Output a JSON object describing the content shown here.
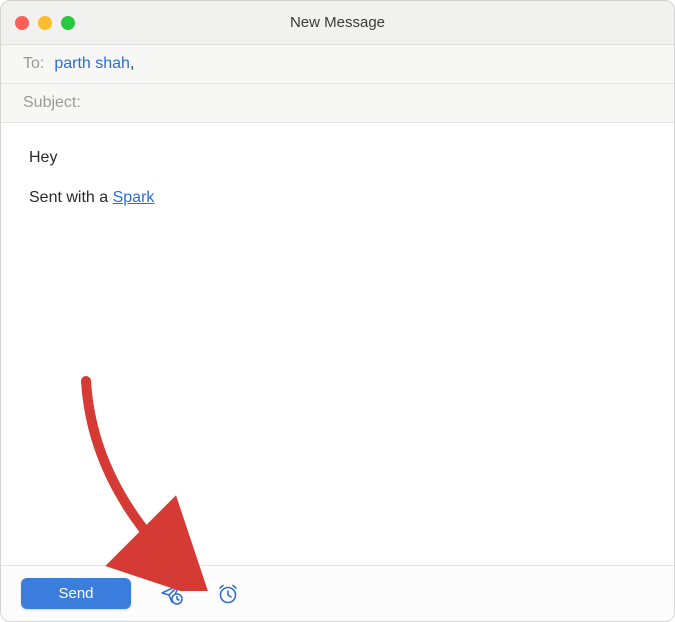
{
  "titlebar": {
    "title": "New Message"
  },
  "to": {
    "label": "To:",
    "recipient": "parth shah",
    "suffix": ","
  },
  "subject": {
    "label": "Subject:"
  },
  "body": {
    "line1": "Hey",
    "signature_prefix": "Sent with a ",
    "signature_link": "Spark"
  },
  "footer": {
    "send_label": "Send"
  }
}
